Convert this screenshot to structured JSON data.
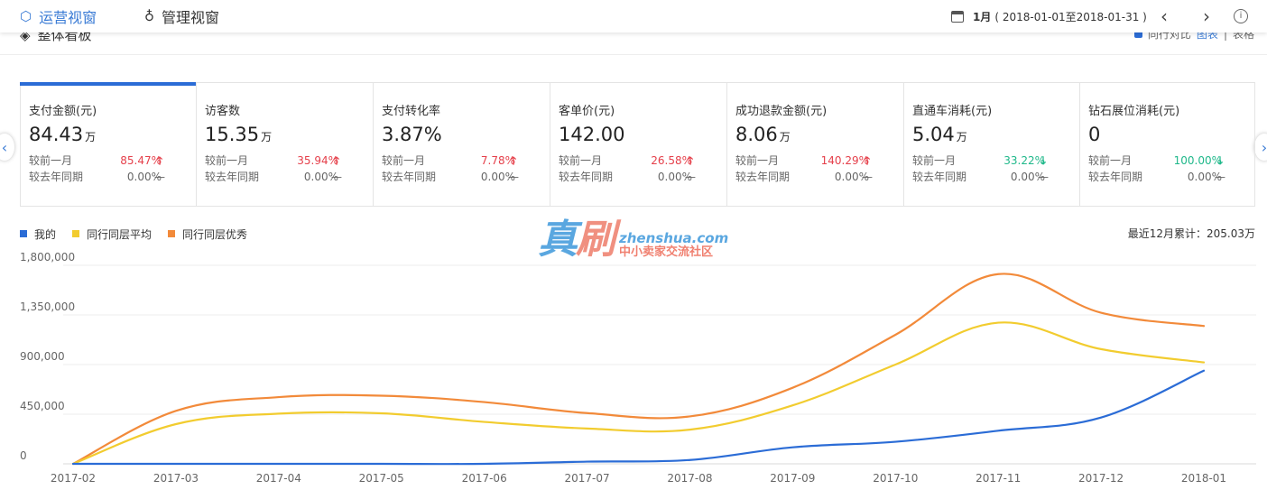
{
  "topbar": {
    "tab_ops": {
      "label": "运营视窗",
      "icon": "hexagon-icon"
    },
    "tab_mgmt": {
      "label": "管理视窗",
      "icon": "medal-icon"
    },
    "date_month": "1月",
    "date_range": "( 2018-01-01至2018-01-31 )",
    "prev_icon": "chevron-left-icon",
    "next_icon": "chevron-right-icon",
    "info_label": "i"
  },
  "subheader": {
    "title": "整体看板",
    "compare_label": "同行对比",
    "view_chart": "图表",
    "separator": "|",
    "view_table": "表格"
  },
  "cards": [
    {
      "title": "支付金额(元)",
      "value": "84.43",
      "unit": "万",
      "mom_label": "较前一月",
      "mom_pct": "85.47%",
      "mom_dir": "up",
      "yoy_label": "较去年同期",
      "yoy_pct": "0.00%",
      "yoy_dir": "flat",
      "active": true
    },
    {
      "title": "访客数",
      "value": "15.35",
      "unit": "万",
      "mom_label": "较前一月",
      "mom_pct": "35.94%",
      "mom_dir": "up",
      "yoy_label": "较去年同期",
      "yoy_pct": "0.00%",
      "yoy_dir": "flat"
    },
    {
      "title": "支付转化率",
      "value": "3.87%",
      "unit": "",
      "mom_label": "较前一月",
      "mom_pct": "7.78%",
      "mom_dir": "up",
      "yoy_label": "较去年同期",
      "yoy_pct": "0.00%",
      "yoy_dir": "flat"
    },
    {
      "title": "客单价(元)",
      "value": "142.00",
      "unit": "",
      "mom_label": "较前一月",
      "mom_pct": "26.58%",
      "mom_dir": "up",
      "yoy_label": "较去年同期",
      "yoy_pct": "0.00%",
      "yoy_dir": "flat"
    },
    {
      "title": "成功退款金额(元)",
      "value": "8.06",
      "unit": "万",
      "mom_label": "较前一月",
      "mom_pct": "140.29%",
      "mom_dir": "up",
      "yoy_label": "较去年同期",
      "yoy_pct": "0.00%",
      "yoy_dir": "flat"
    },
    {
      "title": "直通车消耗(元)",
      "value": "5.04",
      "unit": "万",
      "mom_label": "较前一月",
      "mom_pct": "33.22%",
      "mom_dir": "down",
      "yoy_label": "较去年同期",
      "yoy_pct": "0.00%",
      "yoy_dir": "flat"
    },
    {
      "title": "钻石展位消耗(元)",
      "value": "0",
      "unit": "",
      "mom_label": "较前一月",
      "mom_pct": "100.00%",
      "mom_dir": "down",
      "yoy_label": "较去年同期",
      "yoy_pct": "0.00%",
      "yoy_dir": "flat"
    }
  ],
  "symbols": {
    "up": "🡑",
    "down": "🡓",
    "flat": "—"
  },
  "colors": {
    "up": "#e5404b",
    "down": "#1fb88a",
    "accent": "#2b6cd6",
    "mine": "#2b6cd6",
    "avg": "#f2cc2f",
    "best": "#f28a3a"
  },
  "watermark": {
    "big1": "真",
    "big2": "刷",
    "url": "zhenshua.com",
    "cn": "中小卖家交流社区"
  },
  "chart_summary": "最近12月累计：205.03万",
  "chart_data": {
    "type": "line",
    "categories": [
      "2017-02",
      "2017-03",
      "2017-04",
      "2017-05",
      "2017-06",
      "2017-07",
      "2017-08",
      "2017-09",
      "2017-10",
      "2017-11",
      "2017-12",
      "2018-01"
    ],
    "series": [
      {
        "name": "我的",
        "color": "#2b6cd6",
        "values": [
          0,
          0,
          0,
          0,
          0,
          20000,
          35000,
          150000,
          200000,
          300000,
          420000,
          844300
        ]
      },
      {
        "name": "同行同层平均",
        "color": "#f2cc2f",
        "values": [
          0,
          360000,
          455000,
          458000,
          380000,
          320000,
          310000,
          530000,
          900000,
          1280000,
          1040000,
          920000
        ]
      },
      {
        "name": "同行同层优秀",
        "color": "#f28a3a",
        "values": [
          0,
          480000,
          605000,
          618000,
          560000,
          460000,
          430000,
          690000,
          1170000,
          1720000,
          1370000,
          1250000
        ]
      }
    ],
    "yticks": [
      "1,800,000",
      "1,350,000",
      "900,000",
      "450,000",
      "0"
    ],
    "ylim": [
      0,
      1800000
    ],
    "grid": true,
    "legend": "top-left"
  }
}
